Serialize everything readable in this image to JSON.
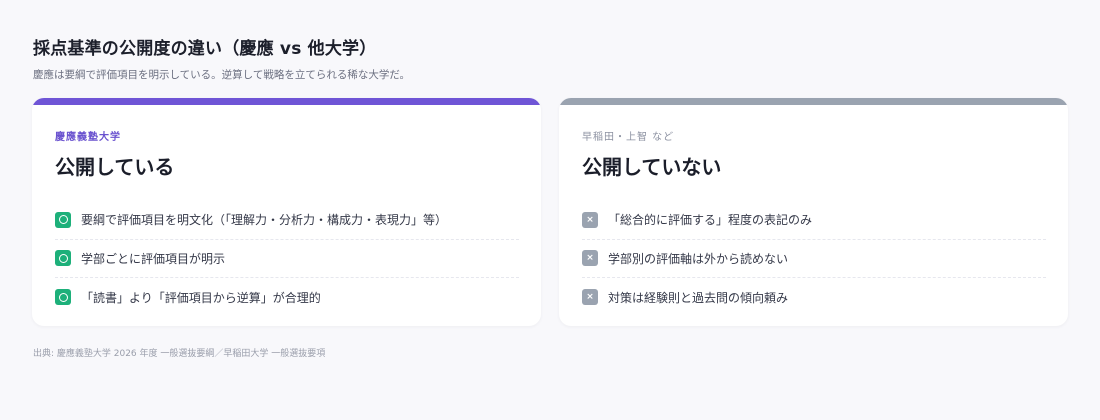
{
  "header": {
    "title": "採点基準の公開度の違い（慶應 vs 他大学）",
    "subtitle": "慶應は要綱で評価項目を明示している。逆算して戦略を立てられる稀な大学だ。"
  },
  "cards": [
    {
      "eyebrow": "慶應義塾大学",
      "heading": "公開している",
      "accent": "#6f55d6",
      "status_icon": "circle-check-icon",
      "items": [
        "要綱で評価項目を明文化（「理解力・分析力・構成力・表現力」等）",
        "学部ごとに評価項目が明示",
        "「読書」より「評価項目から逆算」が合理的"
      ]
    },
    {
      "eyebrow": "早稲田・上智 など",
      "heading": "公開していない",
      "accent": "#9aa3b0",
      "status_icon": "cross-icon",
      "items": [
        "「総合的に評価する」程度の表記のみ",
        "学部別の評価軸は外から読めない",
        "対策は経験則と過去問の傾向頼み"
      ]
    }
  ],
  "footer": "出典: 慶應義塾大学 2026 年度 一般選抜要綱／早稲田大学 一般選抜要項"
}
